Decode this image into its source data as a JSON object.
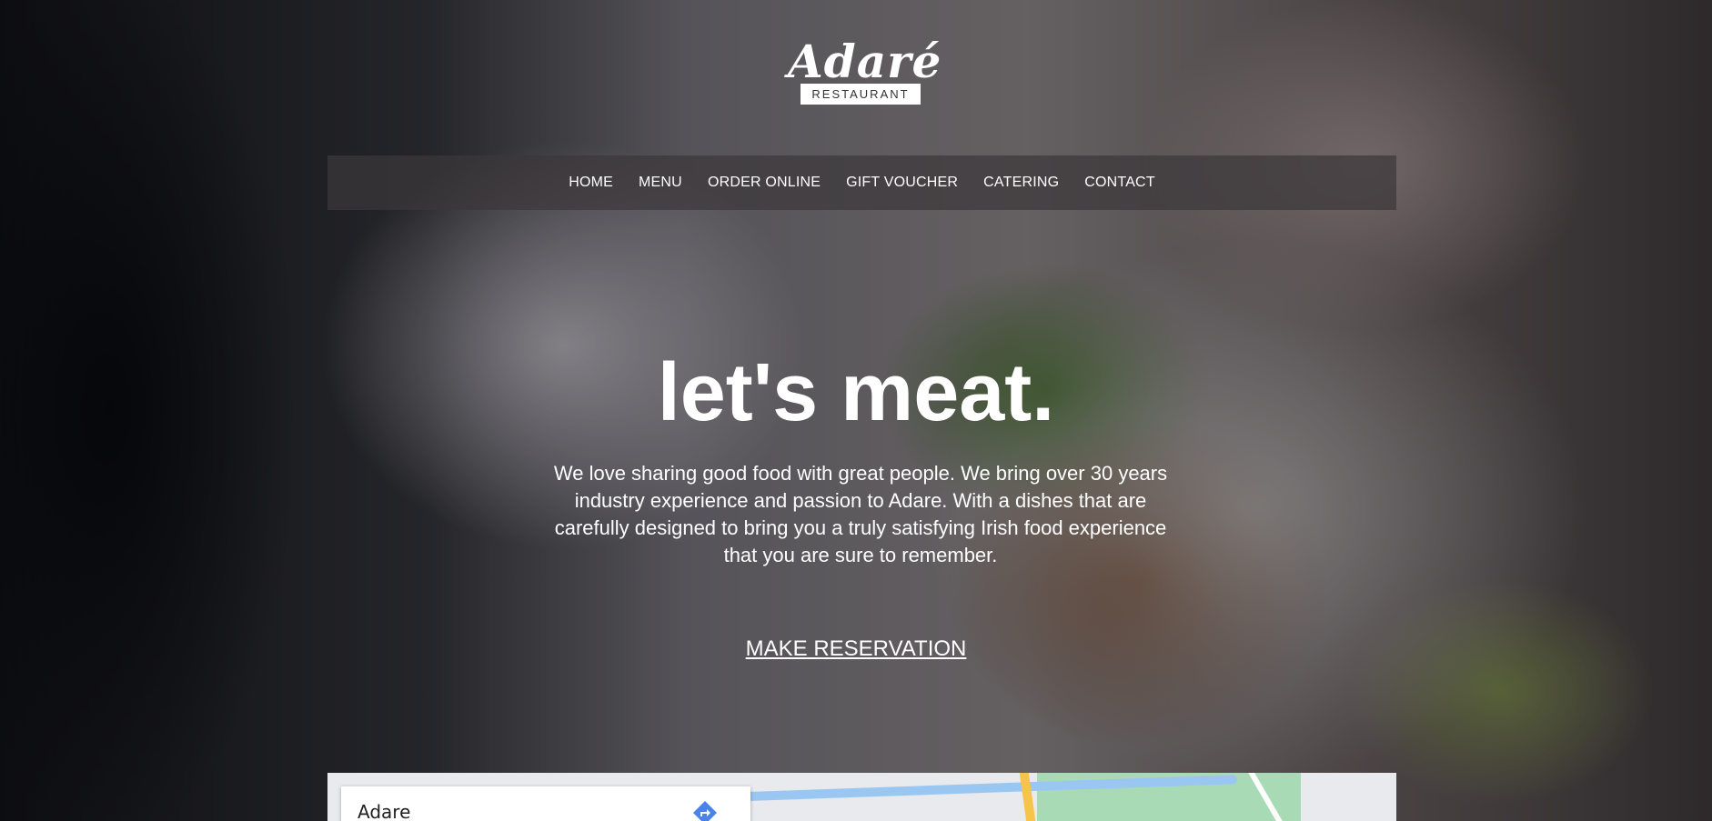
{
  "brand": {
    "name": "Adaré",
    "subtitle": "RESTAURANT"
  },
  "nav": {
    "items": [
      {
        "label": "HOME"
      },
      {
        "label": "MENU"
      },
      {
        "label": "ORDER ONLINE"
      },
      {
        "label": "GIFT VOUCHER"
      },
      {
        "label": "CATERING"
      },
      {
        "label": "CONTACT"
      }
    ]
  },
  "hero": {
    "headline": "let's meat.",
    "intro": "We love sharing good food with great people. We bring over 30 years industry experience and passion to Adare. With a dishes that are carefully designed to bring you a truly satisfying Irish food experience that you are sure to remember.",
    "cta_label": "MAKE RESERVATION"
  },
  "map": {
    "place_name": "Adare",
    "directions_icon": "directions-icon"
  }
}
